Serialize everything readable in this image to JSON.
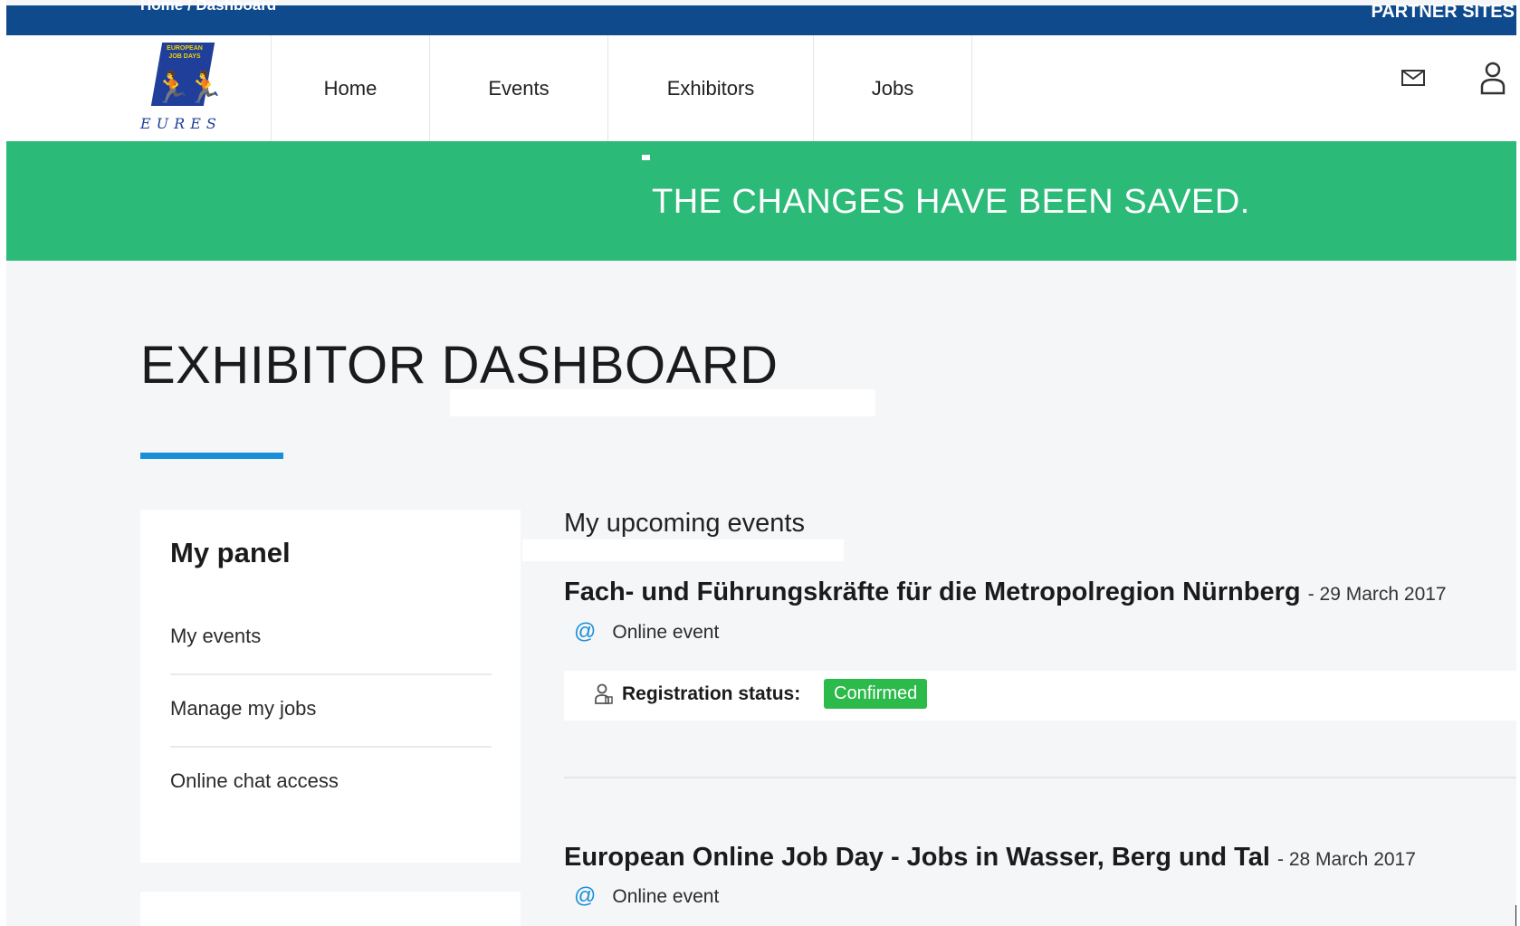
{
  "topbar": {
    "breadcrumb": "Home / Dashboard",
    "partner_sites": "PARTNER SITES"
  },
  "header": {
    "logo": {
      "flag_text": "EUROPEAN JOB DAYS",
      "brand": "EURES"
    },
    "nav": [
      "Home",
      "Events",
      "Exhibitors",
      "Jobs"
    ],
    "icons": {
      "mail": "envelope-icon",
      "user": "user-icon"
    }
  },
  "notice": {
    "message": "THE CHANGES HAVE BEEN SAVED.",
    "color": "#2cba79"
  },
  "page": {
    "title": "EXHIBITOR DASHBOARD",
    "accent": "#1a8fd8"
  },
  "panel": {
    "title": "My panel",
    "links": [
      "My events",
      "Manage my jobs",
      "Online chat access"
    ]
  },
  "events": {
    "section_title": "My upcoming events",
    "items": [
      {
        "name": "Fach- und Führungskräfte für die Metropolregion Nürnberg",
        "date": "- 29 March 2017",
        "type": "Online event",
        "registration_label": "Registration status:",
        "registration_status": "Confirmed"
      },
      {
        "name": "European Online Job Day - Jobs in Wasser, Berg und Tal",
        "date": "- 28 March 2017",
        "type": "Online event"
      }
    ]
  },
  "colors": {
    "topbar": "#0e4a8c",
    "success": "#2cba79",
    "badge": "#2cba4a"
  }
}
